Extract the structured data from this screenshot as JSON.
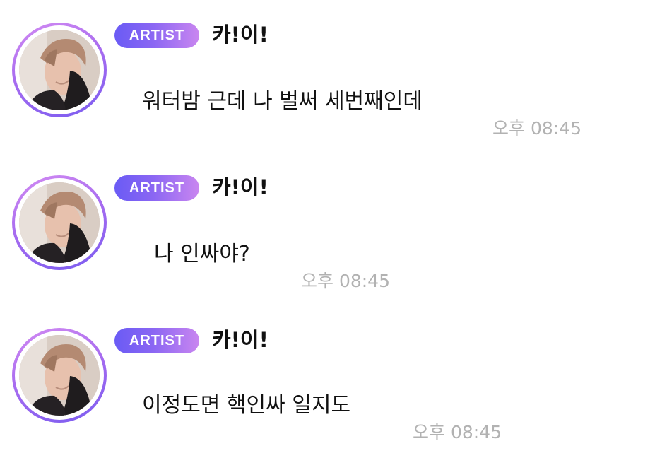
{
  "theme": {
    "badge_gradient": [
      "#6a5bf5",
      "#8a66f3",
      "#c986f0"
    ],
    "avatar_ring_gradient": [
      "#d48cf2",
      "#a86cf0",
      "#7a5cf0"
    ],
    "timestamp_color": "#b2b2b2",
    "text_color": "#111111"
  },
  "messages": [
    {
      "badge": "ARTIST",
      "sender": "카!이!",
      "text": "워터밤 근데 나 벌써 세번째인데",
      "time": "오후 08:45",
      "avatar_icon": "profile-photo"
    },
    {
      "badge": "ARTIST",
      "sender": "카!이!",
      "text": "나 인싸야?",
      "time": "오후 08:45",
      "avatar_icon": "profile-photo"
    },
    {
      "badge": "ARTIST",
      "sender": "카!이!",
      "text": "이정도면 핵인싸 일지도",
      "time": "오후 08:45",
      "avatar_icon": "profile-photo"
    }
  ]
}
